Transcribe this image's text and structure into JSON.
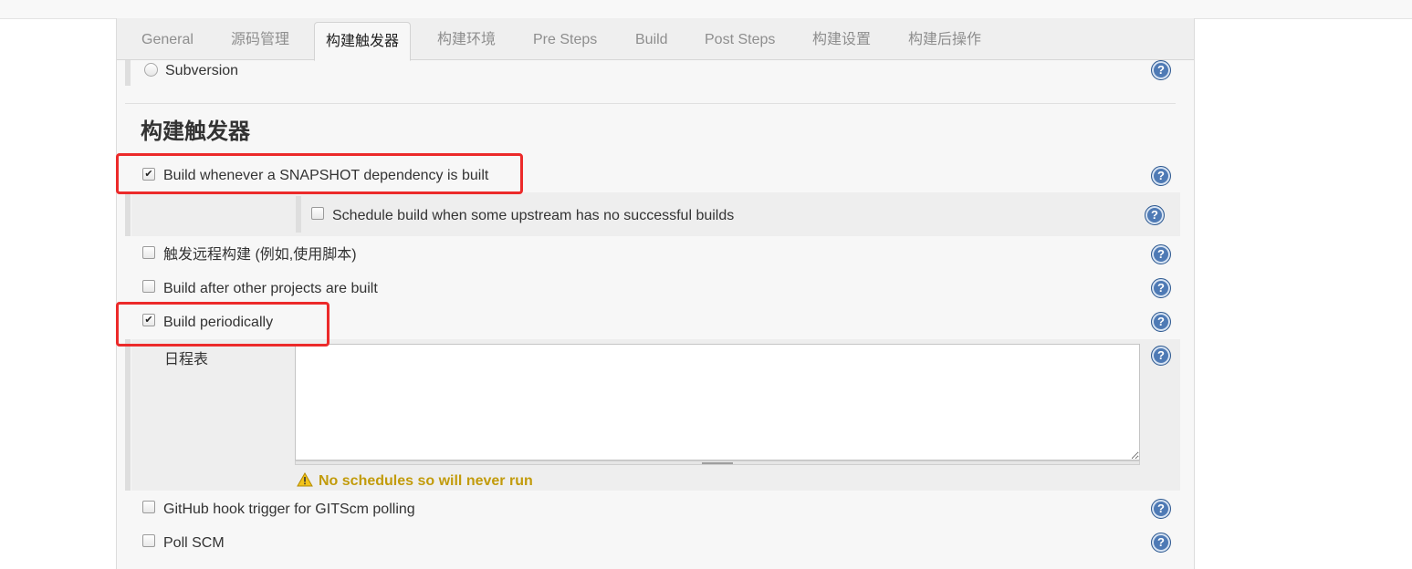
{
  "tabs": [
    {
      "label": "General"
    },
    {
      "label": "源码管理"
    },
    {
      "label": "构建触发器",
      "active": true
    },
    {
      "label": "构建环境"
    },
    {
      "label": "Pre Steps"
    },
    {
      "label": "Build"
    },
    {
      "label": "Post Steps"
    },
    {
      "label": "构建设置"
    },
    {
      "label": "构建后操作"
    }
  ],
  "scm": {
    "subversion_label": "Subversion",
    "subversion_selected": false
  },
  "section": {
    "title": "构建触发器"
  },
  "triggers": {
    "snapshot": {
      "label": "Build whenever a SNAPSHOT dependency is built",
      "checked": true
    },
    "upstream": {
      "label": "Schedule build when some upstream has no successful builds",
      "checked": false
    },
    "remote": {
      "label": "触发远程构建 (例如,使用脚本)",
      "checked": false
    },
    "after_other": {
      "label": "Build after other projects are built",
      "checked": false
    },
    "periodic": {
      "label": "Build periodically",
      "checked": true
    },
    "schedule": {
      "label": "日程表",
      "value": "",
      "warning": "No schedules so will never run"
    },
    "github_hook": {
      "label": "GitHub hook trigger for GITScm polling",
      "checked": false
    },
    "poll_scm": {
      "label": "Poll SCM",
      "checked": false
    }
  },
  "icons": {
    "help": "help-icon",
    "warning": "warning-icon",
    "check": "✔",
    "help_glyph": "?"
  },
  "colors": {
    "highlight": "#ec2a2a",
    "warning_text": "#c29b0b",
    "help_blue": "#4e7ab5"
  }
}
